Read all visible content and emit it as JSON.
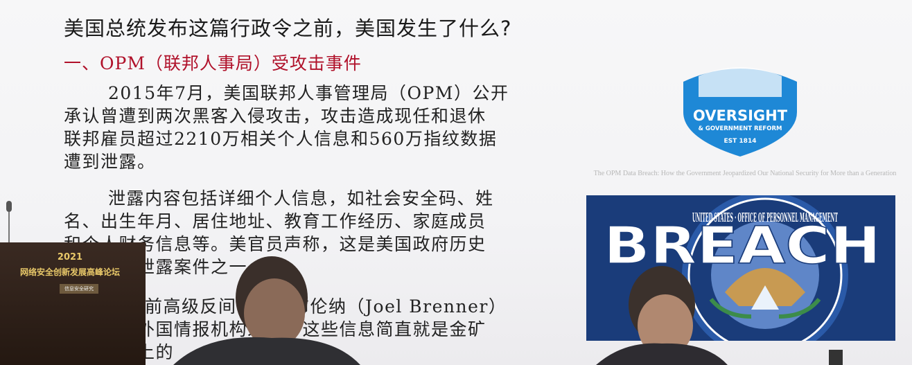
{
  "slide": {
    "title": "美国总统发布这篇行政令之前，美国发生了什么?",
    "subtitle": "一、OPM（联邦人事局）受攻击事件",
    "paragraphs": [
      [
        "2015年7月，美国联邦人事管理局（OPM）公开",
        "承认曾遭到两次黑客入侵攻击，攻击造成现任和退休",
        "联邦雇员超过2210万相关个人信息和560万指纹数据",
        "遭到泄露。"
      ],
      [
        "泄露内容包括详细个人信息，如社会安全码、姓",
        "名、出生年月、居住地址、教育工作经历、家庭成员",
        "和个人财务信息等。美官员声称，这是美国政府历史",
        "上的数据泄露案件之一。"
      ],
      [
        "美国前高级反间谍官员布伦纳（Joel Brenner）",
        "表示，对外国情报机构来说，这些信息简直就是金矿",
        "……事实上的"
      ]
    ],
    "logo": {
      "line1": "OVERSIGHT",
      "line2": "& GOVERNMENT REFORM",
      "line3": "EST 1814",
      "color": "#1e88d6"
    },
    "caption": "The OPM Data Breach: How the Government Jeopardized Our National Security for More than a Generation",
    "breach_image": {
      "word": "BREACH",
      "seal_text": "UNITED STATES · OFFICE OF PERSONNEL MANAGEMENT",
      "bg_color": "#1a3c7a"
    }
  },
  "podium": {
    "year": "2021",
    "event": "网络安全创新发展高峰论坛",
    "badge": "信息安全研究"
  }
}
